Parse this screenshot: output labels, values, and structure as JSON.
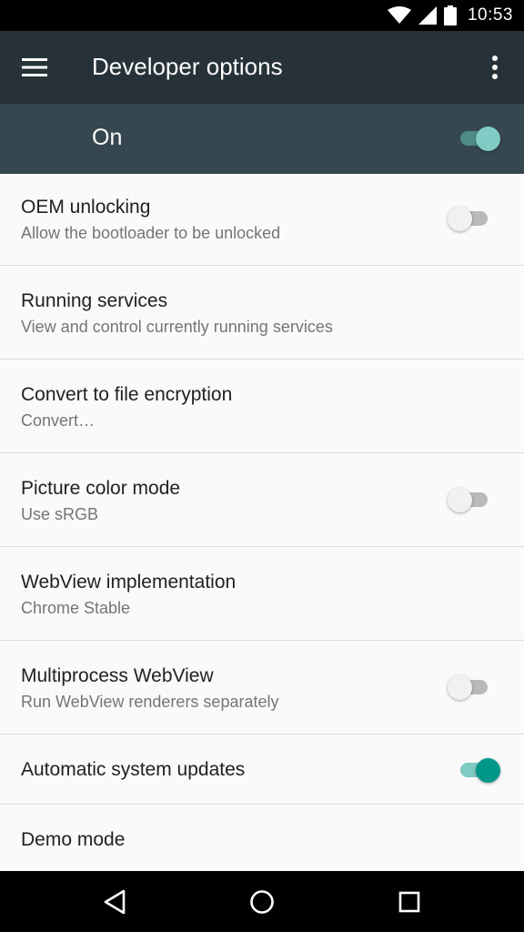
{
  "status_bar": {
    "time": "10:53",
    "icons": [
      "wifi-icon",
      "signal-icon",
      "battery-icon"
    ]
  },
  "app_bar": {
    "title": "Developer options",
    "menu_icon": "hamburger-menu-icon",
    "overflow_icon": "more-vert-icon"
  },
  "master_switch": {
    "label": "On",
    "state": true
  },
  "settings": [
    {
      "title": "OEM unlocking",
      "subtitle": "Allow the bootloader to be unlocked",
      "toggle": false
    },
    {
      "title": "Running services",
      "subtitle": "View and control currently running services"
    },
    {
      "title": "Convert to file encryption",
      "subtitle": "Convert…"
    },
    {
      "title": "Picture color mode",
      "subtitle": "Use sRGB",
      "toggle": false
    },
    {
      "title": "WebView implementation",
      "subtitle": "Chrome Stable"
    },
    {
      "title": "Multiprocess WebView",
      "subtitle": "Run WebView renderers separately",
      "toggle": false
    },
    {
      "title": "Automatic system updates",
      "toggle": true
    },
    {
      "title": "Demo mode"
    }
  ],
  "nav_bar": {
    "icons": [
      "back-icon",
      "home-icon",
      "recents-icon"
    ]
  },
  "colors": {
    "app_bar": "#263238",
    "master_bar": "#37474f",
    "accent": "#009688",
    "accent_light": "#80cbc4"
  }
}
